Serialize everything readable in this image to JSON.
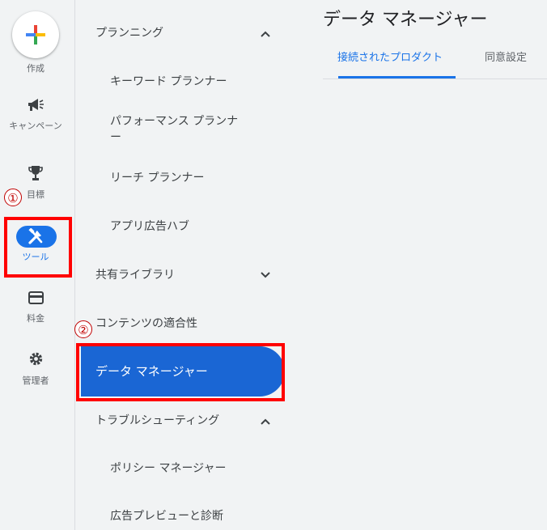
{
  "rail": {
    "create_label": "作成",
    "items": [
      {
        "label": "キャンペーン",
        "icon": "megaphone-icon"
      },
      {
        "label": "目標",
        "icon": "trophy-icon"
      },
      {
        "label": "ツール",
        "icon": "tools-icon"
      },
      {
        "label": "料金",
        "icon": "credit-card-icon"
      },
      {
        "label": "管理者",
        "icon": "gear-icon"
      }
    ]
  },
  "nav": {
    "planning": "プランニング",
    "keyword_planner": "キーワード プランナー",
    "performance_planner_line1": "パフォーマンス プランナ",
    "performance_planner_line2": "ー",
    "reach_planner": "リーチ プランナー",
    "app_ad_hub": "アプリ広告ハブ",
    "shared_library": "共有ライブラリ",
    "content_suitability": "コンテンツの適合性",
    "data_manager": "データ マネージャー",
    "troubleshooting": "トラブルシューティング",
    "policy_manager": "ポリシー マネージャー",
    "ad_preview": "広告プレビューと診断"
  },
  "main": {
    "title": "データ マネージャー",
    "tabs": [
      {
        "label": "接続されたプロダクト",
        "active": true
      },
      {
        "label": "同意設定",
        "active": false
      }
    ]
  },
  "annotations": {
    "step1": "①",
    "step2": "②",
    "highlight_color": "#ff0000"
  },
  "colors": {
    "accent": "#1a73e8",
    "active_bg": "#1a66d4"
  }
}
